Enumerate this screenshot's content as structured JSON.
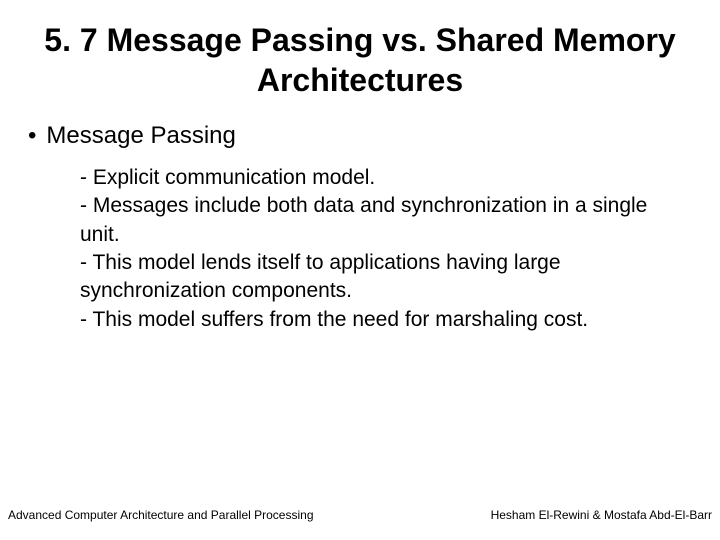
{
  "title": "5. 7 Message Passing vs. Shared Memory Architectures",
  "bullet": {
    "marker": "•",
    "label": "Message Passing"
  },
  "points": [
    "- Explicit communication model.",
    "- Messages include both data and synchronization in a single unit.",
    "- This model lends itself to applications having large synchronization components.",
    "- This model suffers from the need for marshaling cost."
  ],
  "footer": {
    "left": "Advanced Computer Architecture and Parallel Processing",
    "right": "Hesham El-Rewini & Mostafa Abd-El-Barr"
  }
}
